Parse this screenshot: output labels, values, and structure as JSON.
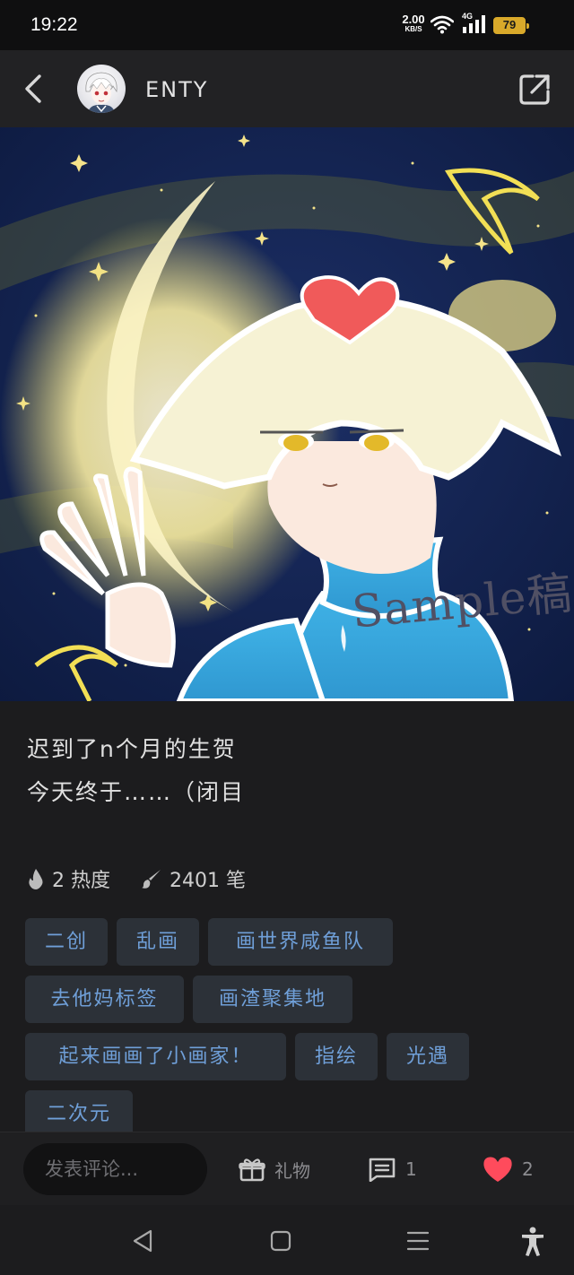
{
  "status_bar": {
    "time": "19:22",
    "net_speed_value": "2.00",
    "net_speed_unit": "KB/S",
    "network_type": "4G",
    "battery": "79",
    "icons": [
      "wifi-icon",
      "cellular-signal-icon",
      "battery-icon"
    ]
  },
  "header": {
    "username": "ENTY",
    "icons": [
      "back-arrow-icon",
      "avatar",
      "share-icon"
    ]
  },
  "artwork": {
    "watermark": "Sample稿"
  },
  "post": {
    "description": [
      "迟到了n个月的生贺",
      "今天终于……（闭目"
    ],
    "stats": {
      "heat": "2 热度",
      "strokes": "2401 笔"
    },
    "tags": [
      "二创",
      "乱画",
      "画世界咸鱼队",
      "去他妈标签",
      "画渣聚集地",
      "起来画画了小画家！",
      "指绘",
      "光遇",
      "二次元"
    ]
  },
  "action_bar": {
    "comment_placeholder": "发表评论...",
    "gift_label": "礼物",
    "comment_count": "1",
    "like_count": "2",
    "like_color": "#ff4b5c"
  },
  "system_nav": {
    "icons": [
      "back-triangle-icon",
      "home-square-icon",
      "menu-lines-icon",
      "accessibility-icon"
    ]
  }
}
